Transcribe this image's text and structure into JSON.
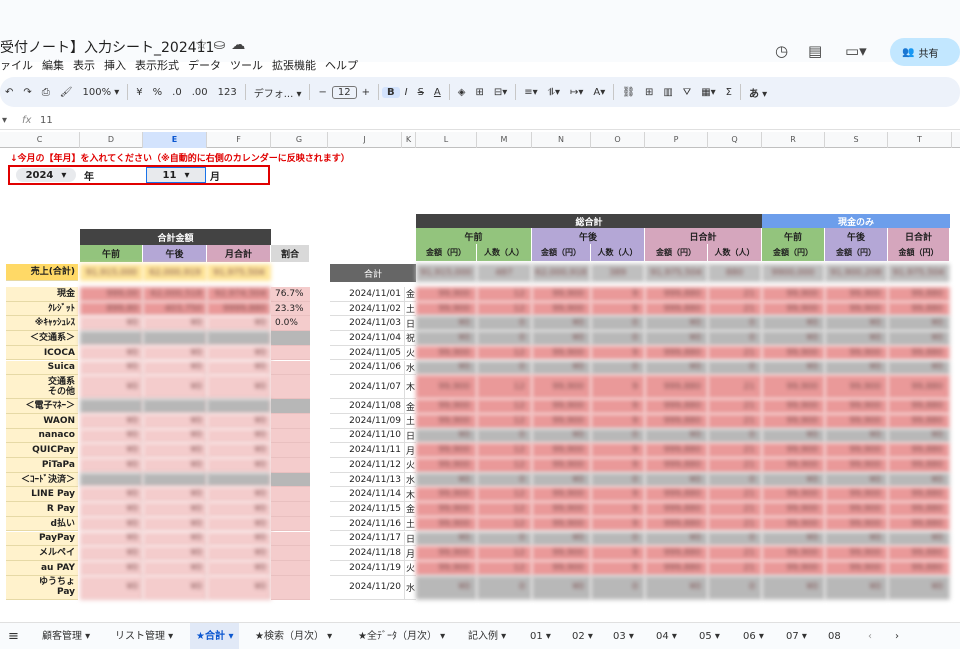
{
  "title": {
    "doc": "受付ノート】入力シート_202411",
    "icons": [
      "star-icon",
      "folder-icon",
      "cloud-icon"
    ]
  },
  "menu": [
    "ァイル",
    "編集",
    "表示",
    "挿入",
    "表示形式",
    "データ",
    "ツール",
    "拡張機能",
    "ヘルプ"
  ],
  "share_label": "共有",
  "toolbar": {
    "zoom": "100%",
    "currency": "¥",
    "percent": "%",
    "dec_down": ".0",
    "dec_up": ".00",
    "fmt123": "123",
    "font": "デフォ...",
    "minus": "−",
    "font_size": "12",
    "plus": "+",
    "bold": "B",
    "italic": "I",
    "strike": "S",
    "textcolor": "A",
    "sigma": "Σ",
    "ime": "あ"
  },
  "formula": {
    "cell_ref": "",
    "fx": "fx",
    "value": "11"
  },
  "columns": [
    "C",
    "D",
    "E",
    "F",
    "G",
    "J",
    "K",
    "L",
    "M",
    "N",
    "O",
    "P",
    "Q",
    "R",
    "S",
    "T"
  ],
  "notice": "↓今月の【年月】を入れてください（※自動的に右側のカレンダーに反映されます）",
  "year_value": "2024",
  "year_label": "年",
  "month_value": "11",
  "month_label": "月",
  "left_table": {
    "header": "合計金額",
    "cols": [
      "午前",
      "午後",
      "月合計",
      "割合"
    ],
    "sales_label": "売上(合計)",
    "sales_vals": [
      "91,915,000",
      "62,000,919",
      "91,975,504"
    ],
    "rows": [
      {
        "label": "現金",
        "vals": [
          "999,00",
          "62,000,518",
          "92,974,504"
        ],
        "ratio": "76.7%",
        "style": "pink"
      },
      {
        "label": "ｸﾚｼﾞｯﾄ",
        "vals": [
          "899,80",
          "403,750",
          "9999,880"
        ],
        "ratio": "23.3%",
        "style": "pink"
      },
      {
        "label": "※ｷｬｯｼｭﾚｽ",
        "vals": [
          "¥0",
          "¥0",
          "¥0"
        ],
        "ratio": "0.0%",
        "style": "lpink"
      },
      {
        "label": "＜交通系＞",
        "vals": [
          "",
          "",
          ""
        ],
        "ratio": "",
        "style": "gray"
      },
      {
        "label": "ICOCA",
        "vals": [
          "¥0",
          "¥0",
          "¥0"
        ],
        "ratio": "",
        "style": "lpink"
      },
      {
        "label": "Suica",
        "vals": [
          "¥0",
          "¥0",
          "¥0"
        ],
        "ratio": "",
        "style": "lpink"
      },
      {
        "label": "交通系\nその他",
        "vals": [
          "¥0",
          "¥0",
          "¥0"
        ],
        "ratio": "",
        "style": "lpink",
        "tall": true
      },
      {
        "label": "＜電子ﾏﾈｰ＞",
        "vals": [
          "",
          "",
          ""
        ],
        "ratio": "",
        "style": "gray"
      },
      {
        "label": "WAON",
        "vals": [
          "¥0",
          "¥0",
          "¥0"
        ],
        "ratio": "",
        "style": "lpink"
      },
      {
        "label": "nanaco",
        "vals": [
          "¥0",
          "¥0",
          "¥0"
        ],
        "ratio": "",
        "style": "lpink"
      },
      {
        "label": "QUICPay",
        "vals": [
          "¥0",
          "¥0",
          "¥0"
        ],
        "ratio": "",
        "style": "lpink"
      },
      {
        "label": "PiTaPa",
        "vals": [
          "¥0",
          "¥0",
          "¥0"
        ],
        "ratio": "",
        "style": "lpink"
      },
      {
        "label": "＜ｺｰﾄﾞ決済＞",
        "vals": [
          "",
          "",
          ""
        ],
        "ratio": "",
        "style": "gray"
      },
      {
        "label": "LINE Pay",
        "vals": [
          "¥0",
          "¥0",
          "¥0"
        ],
        "ratio": "",
        "style": "lpink"
      },
      {
        "label": "R Pay",
        "vals": [
          "¥0",
          "¥0",
          "¥0"
        ],
        "ratio": "",
        "style": "lpink"
      },
      {
        "label": "d払い",
        "vals": [
          "¥0",
          "¥0",
          "¥0"
        ],
        "ratio": "",
        "style": "lpink"
      },
      {
        "label": "PayPay",
        "vals": [
          "¥0",
          "¥0",
          "¥0"
        ],
        "ratio": "",
        "style": "lpink"
      },
      {
        "label": "メルペイ",
        "vals": [
          "¥0",
          "¥0",
          "¥0"
        ],
        "ratio": "",
        "style": "lpink"
      },
      {
        "label": "au PAY",
        "vals": [
          "¥0",
          "¥0",
          "¥0"
        ],
        "ratio": "",
        "style": "lpink"
      },
      {
        "label": "ゆうちょ\nPay",
        "vals": [
          "¥0",
          "¥0",
          "¥0"
        ],
        "ratio": "",
        "style": "lpink",
        "tall": true
      }
    ]
  },
  "right_table": {
    "total_header": "総合計",
    "cash_header": "現金のみ",
    "groups": [
      "午前",
      "午後",
      "日合計",
      "午前",
      "午後",
      "日合計"
    ],
    "sub": [
      "金額（円）",
      "人数（人）",
      "金額（円）",
      "人数（人）",
      "金額（円）",
      "人数（人）",
      "金額（円）",
      "金額（円）",
      "金額（円）"
    ],
    "total_label": "合計",
    "total_vals": [
      "91,915,000",
      "487",
      "62,000,918",
      "389",
      "91,975,504",
      "880",
      "9900,000",
      "91,900,208",
      "91,975,504"
    ],
    "days": [
      {
        "date": "2024/11/01",
        "dow": "金",
        "style": "pink"
      },
      {
        "date": "2024/11/02",
        "dow": "土",
        "style": "pink"
      },
      {
        "date": "2024/11/03",
        "dow": "日",
        "style": "gray"
      },
      {
        "date": "2024/11/04",
        "dow": "祝",
        "style": "gray"
      },
      {
        "date": "2024/11/05",
        "dow": "火",
        "style": "pink"
      },
      {
        "date": "2024/11/06",
        "dow": "水",
        "style": "gray"
      },
      {
        "date": "2024/11/07",
        "dow": "木",
        "style": "pink",
        "tall": true
      },
      {
        "date": "2024/11/08",
        "dow": "金",
        "style": "pink"
      },
      {
        "date": "2024/11/09",
        "dow": "土",
        "style": "pink"
      },
      {
        "date": "2024/11/10",
        "dow": "日",
        "style": "gray"
      },
      {
        "date": "2024/11/11",
        "dow": "月",
        "style": "pink"
      },
      {
        "date": "2024/11/12",
        "dow": "火",
        "style": "pink"
      },
      {
        "date": "2024/11/13",
        "dow": "水",
        "style": "gray"
      },
      {
        "date": "2024/11/14",
        "dow": "木",
        "style": "pink"
      },
      {
        "date": "2024/11/15",
        "dow": "金",
        "style": "pink"
      },
      {
        "date": "2024/11/16",
        "dow": "土",
        "style": "pink"
      },
      {
        "date": "2024/11/17",
        "dow": "日",
        "style": "gray"
      },
      {
        "date": "2024/11/18",
        "dow": "月",
        "style": "pink"
      },
      {
        "date": "2024/11/19",
        "dow": "火",
        "style": "pink"
      },
      {
        "date": "2024/11/20",
        "dow": "水",
        "style": "gray",
        "tall": true
      }
    ],
    "pink_vals": [
      "99,900",
      "12",
      "99,900",
      "9",
      "999,880",
      "21",
      "99,900",
      "99,900",
      "99,880"
    ],
    "gray_vals": [
      "¥0",
      "0",
      "¥0",
      "0",
      "¥0",
      "0",
      "¥0",
      "¥0",
      "¥0"
    ]
  },
  "tabs": [
    "顧客管理 ▾",
    "リスト管理 ▾",
    "★合計 ▾",
    "★検索（月次） ▾",
    "★全ﾃﾞｰﾀ（月次） ▾",
    "記入例 ▾",
    "01 ▾",
    "02 ▾",
    "03 ▾",
    "04 ▾",
    "05 ▾",
    "06 ▾",
    "07 ▾",
    "08"
  ],
  "active_tab": 2,
  "colors": {
    "green": "#93c47d",
    "purple": "#b4a7d6",
    "pinkhdr": "#d5a6bd",
    "blue": "#6d9eeb",
    "dark": "#434343",
    "yellow": "#fff2cc",
    "red": "#e00000"
  }
}
